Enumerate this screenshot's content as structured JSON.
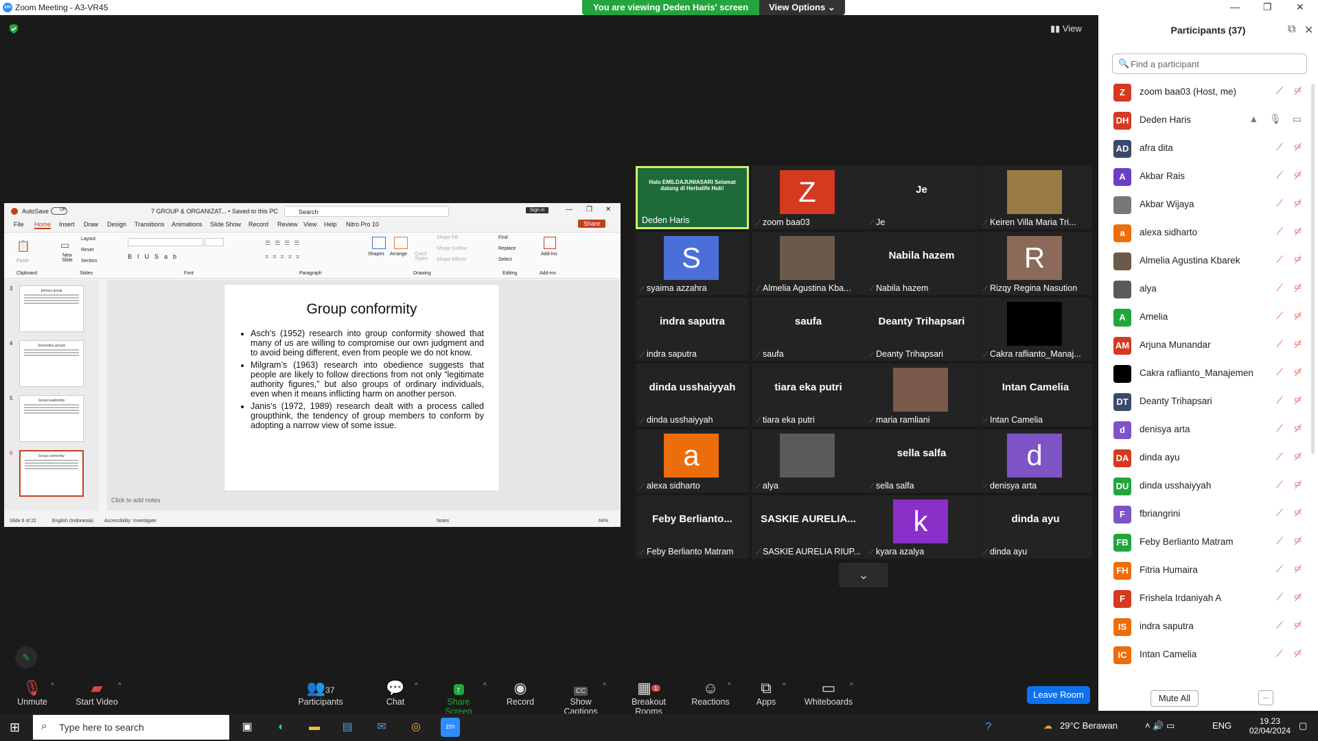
{
  "window": {
    "title": "Zoom Meeting - A3-VR45",
    "banner": "You are viewing Deden Haris' screen",
    "view_options": "View Options",
    "view_label": "View"
  },
  "ppt": {
    "autosave": "AutoSave",
    "autosave_state": "Off",
    "filename": "7 GROUP & ORGANIZAT... • Saved to this PC",
    "search": "Search",
    "signin": "Sign in",
    "tabs": [
      "File",
      "Home",
      "Insert",
      "Draw",
      "Design",
      "Transitions",
      "Animations",
      "Slide Show",
      "Record",
      "Review",
      "View",
      "Help",
      "Nitro Pro 10"
    ],
    "share": "Share",
    "groups": [
      "Clipboard",
      "Slides",
      "Font",
      "Paragraph",
      "Drawing",
      "Editing",
      "Add-ins"
    ],
    "ribbon_items": {
      "paste": "Paste",
      "new_slide": "New Slide",
      "layout": "Layout",
      "reset": "Reset",
      "section": "Section",
      "shapes": "Shapes",
      "arrange": "Arrange",
      "quick_styles": "Quick Styles",
      "shape_fill": "Shape Fill",
      "shape_outline": "Shape Outline",
      "shape_effects": "Shape Effects",
      "find": "Find",
      "replace": "Replace",
      "select": "Select",
      "addins": "Add-ins"
    },
    "thumbs": [
      {
        "num": "3",
        "title": "primary group"
      },
      {
        "num": "4",
        "title": "Secondary groups"
      },
      {
        "num": "5",
        "title": "Group leadership"
      },
      {
        "num": "6",
        "title": "Group conformity"
      }
    ],
    "slide": {
      "title": "Group conformity",
      "bullets": [
        "Asch’s (1952) research into group conformity showed that many of us are willing to compromise our own judgment and to avoid being different, even from people we do not know.",
        "Milgram’s (1963) research into obedience suggests that people are likely to follow directions from not only “legitimate authority figures,” but also groups of ordinary individuals, even when it means inflicting harm on another person.",
        "Janis’s (1972, 1989) research dealt with a process called groupthink, the tendency of group members to conform by adopting a narrow view of some issue."
      ]
    },
    "notes": "Click to add notes",
    "status": {
      "slide": "Slide 6 of 22",
      "lang": "English (Indonesia)",
      "access": "Accessibility: Investigate",
      "notes": "Notes",
      "zoom": "64%"
    }
  },
  "tiles": [
    {
      "name": "Deden Haris",
      "big": "",
      "av": "",
      "color": "",
      "active": true,
      "vid_text": "Halo EMILDAJUNIASARI Selamat datang di Herbalife Hub!"
    },
    {
      "name": "zoom baa03",
      "big": "",
      "av": "Z",
      "color": "#d5391f"
    },
    {
      "name": "Je",
      "big": "Je",
      "av": "",
      "color": ""
    },
    {
      "name": "Keiren Villa Maria Tri...",
      "big": "",
      "av": "",
      "color": "#9a7a45"
    },
    {
      "name": "syaima azzahra",
      "big": "",
      "av": "S",
      "color": "#4a6fd8"
    },
    {
      "name": "Almelia Agustina Kba...",
      "big": "",
      "av": "",
      "color": "#6b5a4a"
    },
    {
      "name": "Nabila hazem",
      "big": "Nabila hazem",
      "av": "",
      "color": ""
    },
    {
      "name": "Rizqy Regina Nasution",
      "big": "",
      "av": "R",
      "color": "#8b6a5a"
    },
    {
      "name": "indra saputra",
      "big": "indra saputra",
      "av": "",
      "color": ""
    },
    {
      "name": "saufa",
      "big": "saufa",
      "av": "",
      "color": ""
    },
    {
      "name": "Deanty Trihapsari",
      "big": "Deanty Trihapsari",
      "av": "",
      "color": ""
    },
    {
      "name": "Cakra raflianto_Manaj...",
      "big": "",
      "av": "",
      "color": "#000"
    },
    {
      "name": "dinda usshaiyyah",
      "big": "dinda usshaiyyah",
      "av": "",
      "color": ""
    },
    {
      "name": "tiara eka putri",
      "big": "tiara eka putri",
      "av": "",
      "color": ""
    },
    {
      "name": "maria ramliani",
      "big": "",
      "av": "",
      "color": "#7a5a4a"
    },
    {
      "name": "Intan Camelia",
      "big": "Intan Camelia",
      "av": "",
      "color": ""
    },
    {
      "name": "alexa sidharto",
      "big": "",
      "av": "a",
      "color": "#ee6d0b"
    },
    {
      "name": "alya",
      "big": "",
      "av": "",
      "color": "#5a5a5a"
    },
    {
      "name": "sella salfa",
      "big": "sella salfa",
      "av": "",
      "color": ""
    },
    {
      "name": "denisya arta",
      "big": "",
      "av": "d",
      "color": "#7e53c6"
    },
    {
      "name": "Feby Berlianto Matram",
      "big": "Feby  Berlianto...",
      "av": "",
      "color": ""
    },
    {
      "name": "SASKIE AURELIA RIUP...",
      "big": "SASKIE AURELIA...",
      "av": "",
      "color": ""
    },
    {
      "name": "kyara azalya",
      "big": "",
      "av": "k",
      "color": "#8b2fc9"
    },
    {
      "name": "dinda ayu",
      "big": "dinda ayu",
      "av": "",
      "color": ""
    }
  ],
  "panel": {
    "title": "Participants (37)",
    "search_placeholder": "Find a participant",
    "mute_all": "Mute All",
    "more": "...",
    "participants": [
      {
        "init": "Z",
        "name": "zoom baa03 (Host, me)",
        "color": "#d5391f"
      },
      {
        "init": "DH",
        "name": "Deden Haris",
        "color": "#d5391f"
      },
      {
        "init": "AD",
        "name": "afra dita",
        "color": "#394a6b"
      },
      {
        "init": "A",
        "name": "Akbar Rais",
        "color": "#6a3fc5"
      },
      {
        "init": "",
        "name": "Akbar Wijaya",
        "color": "#777"
      },
      {
        "init": "a",
        "name": "alexa sidharto",
        "color": "#ee6d0b"
      },
      {
        "init": "",
        "name": "Almelia Agustina Kbarek",
        "color": "#6b5a4a"
      },
      {
        "init": "",
        "name": "alya",
        "color": "#5a5a5a"
      },
      {
        "init": "A",
        "name": "Amelia",
        "color": "#23a53d"
      },
      {
        "init": "AM",
        "name": "Arjuna Munandar",
        "color": "#d5391f"
      },
      {
        "init": "",
        "name": "Cakra raflianto_Manajemen",
        "color": "#000"
      },
      {
        "init": "DT",
        "name": "Deanty Trihapsari",
        "color": "#394a6b"
      },
      {
        "init": "d",
        "name": "denisya arta",
        "color": "#7e53c6"
      },
      {
        "init": "DA",
        "name": "dinda ayu",
        "color": "#d5391f"
      },
      {
        "init": "DU",
        "name": "dinda usshaiyyah",
        "color": "#23a53d"
      },
      {
        "init": "F",
        "name": "fbriangrini",
        "color": "#7e53c6"
      },
      {
        "init": "FB",
        "name": "Feby Berlianto Matram",
        "color": "#23a53d"
      },
      {
        "init": "FH",
        "name": "Fitria Humaira",
        "color": "#ee6d0b"
      },
      {
        "init": "F",
        "name": "Frishela Irdaniyah A",
        "color": "#d5391f"
      },
      {
        "init": "IS",
        "name": "indra saputra",
        "color": "#ee6d0b"
      },
      {
        "init": "IC",
        "name": "Intan Camelia",
        "color": "#ee6d0b"
      }
    ]
  },
  "toolbar": {
    "unmute": "Unmute",
    "start_video": "Start Video",
    "participants": "Participants",
    "participants_count": "37",
    "chat": "Chat",
    "share": "Share Screen",
    "record": "Record",
    "captions": "Show Captions",
    "breakout": "Breakout Rooms",
    "breakout_badge": "1",
    "reactions": "Reactions",
    "apps": "Apps",
    "whiteboards": "Whiteboards",
    "leave": "Leave Room",
    "cc": "CC"
  },
  "taskbar": {
    "search": "Type here to search",
    "weather": "29°C  Berawan",
    "lang": "ENG",
    "time": "19.23",
    "date": "02/04/2024"
  }
}
